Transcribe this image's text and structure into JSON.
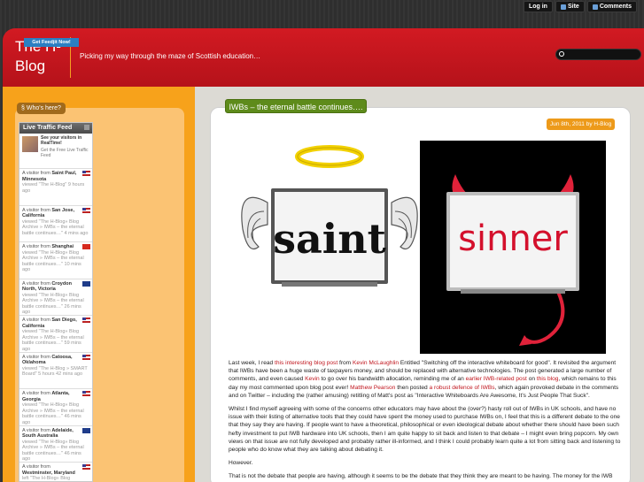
{
  "topbar": {
    "login_label": "Log in",
    "site_label": "Site",
    "comments_label": "Comments"
  },
  "header": {
    "title": "The H-Blog",
    "tagline": "Picking my way through the maze of Scottish education…",
    "search_placeholder": ""
  },
  "sidebar": {
    "whos_here_label": "§ Who's here?",
    "feed": {
      "title": "Live Traffic Feed",
      "promo_title": "See your visitors in RealTime!",
      "promo_sub": "Get the Free Live Traffic Feed",
      "get_button": "Get Feedjit Now!",
      "visits": [
        {
          "place": "Saint Paul, Minnesota",
          "page": "viewed \"The H-Blog\"",
          "ago": "9 hours ago",
          "flag": "us"
        },
        {
          "place": "San Jose, California",
          "page": "viewed \"The H-Blog» Blog Archive » IWBs – the eternal battle continues…\"",
          "ago": "4 mins ago",
          "flag": "us"
        },
        {
          "place": "Shanghai",
          "page": "viewed \"The H-Blog» Blog Archive » IWBs – the eternal battle continues…\"",
          "ago": "10 mins ago",
          "flag": "cn"
        },
        {
          "place": "Croydon North, Victoria",
          "page": "viewed \"The H-Blog» Blog Archive » IWBs – the eternal battle continues…\"",
          "ago": "26 mins ago",
          "flag": "au"
        },
        {
          "place": "San Diego, California",
          "page": "viewed \"The H-Blog» Blog Archive » IWBs – the eternal battle continues…\"",
          "ago": "59 mins ago",
          "flag": "us"
        },
        {
          "place": "Catoosa, Oklahoma",
          "page": "viewed \"The H-Blog » SMART Board\"",
          "ago": "5 hours 42 mins ago",
          "flag": "us"
        },
        {
          "place": "Atlanta, Georgia",
          "page": "viewed \"The H-Blog» Blog Archive » IWBs – the eternal battle continues…\"",
          "ago": "46 mins ago",
          "flag": "us"
        },
        {
          "place": "Adelaide, South Australia",
          "page": "viewed \"The H-Blog» Blog Archive » IWBs – the eternal battle continues…\"",
          "ago": "46 mins ago",
          "flag": "au"
        },
        {
          "place": "Westminster, Maryland",
          "page": "left \"The H-Blog» Blog",
          "ago": "",
          "flag": "us"
        }
      ],
      "visitor_prefix": "A visitor from"
    }
  },
  "post": {
    "title": "IWBs – the eternal battle continues….",
    "date": "Jun 8th, 2011 by H-Blog",
    "image_words": {
      "left": "saint",
      "right": "sinner"
    },
    "p1": {
      "t1": "Last week, I read ",
      "l1": "this interesting blog post",
      "t2": " from ",
      "l2": "Kevin McLaughlin",
      "t3": " Entitled \"Switching off the interactive whiteboard for good\". It revisited the argument that IWBs have been a huge waste of taxpayers money, and should be replaced with alternative technologies. The post generated a large number of comments, and even caused ",
      "l3": "Kevin",
      "t4": " to go over his bandwidth allocation, reminding me of an ",
      "l4": "earlier IWB-related post",
      "t5": " on ",
      "l5": "this blog",
      "t6": ", which remains to this day my most commented upon blog post ever! ",
      "l6": "Matthew Pearson",
      "t7": " then posted ",
      "l7": "a robust defence of IWBs",
      "t8": ", which again provoked debate in the comments and on Twitter – including the (rather amusing) retitling of Matt's post as \"Interactive Whiteboards Are Awesome, It's Just People That Suck\"."
    },
    "p2": "Whilst I find myself agreeing with some of the concerns other educators may have about the (over?) hasty roll out of IWBs in UK schools, and have no issue with their listing of alternative tools that they could have spent the money used to purchase IWBs on, I feel that this is a different debate to the one that they say they are having. If people want to have a theoretical, philosophical or even ideological debate about whether there should have been such hefty investment to put IWB hardware into UK schools, then I am quite happy to sit back and listen to that debate – I might even bring popcorn. My own views on that issue are not fully developed and probably rather ill-informed, and I think I could probably learn quite a lot from sitting back and listening to people who do know what they are talking about debating it.",
    "p3": "However.",
    "p4": "That is not the debate that people are having, although it seems to be the debate that they think they are meant to be having. The money for the IWB"
  },
  "colors": {
    "header_red": "#c0141c",
    "sidebar_orange": "#f7a21b",
    "title_green": "#5e8b1b",
    "link_red": "#c0141c"
  }
}
